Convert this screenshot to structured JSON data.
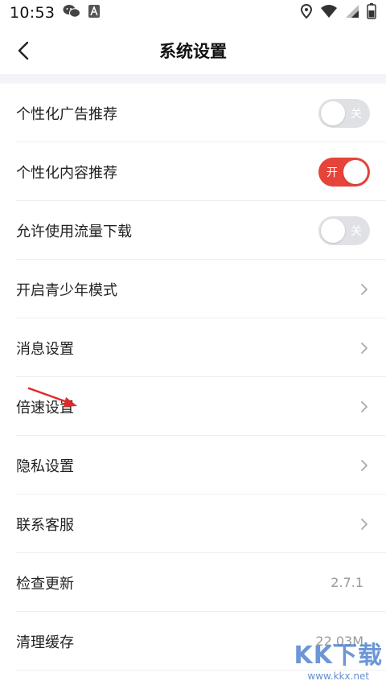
{
  "status": {
    "time": "10:53"
  },
  "header": {
    "title": "系统设置"
  },
  "settings": {
    "items": [
      {
        "label": "个性化广告推荐",
        "toggle_text": "关"
      },
      {
        "label": "个性化内容推荐",
        "toggle_text": "开"
      },
      {
        "label": "允许使用流量下载",
        "toggle_text": "关"
      },
      {
        "label": "开启青少年模式"
      },
      {
        "label": "消息设置"
      },
      {
        "label": "倍速设置"
      },
      {
        "label": "隐私设置"
      },
      {
        "label": "联系客服"
      },
      {
        "label": "检查更新",
        "value": "2.7.1"
      },
      {
        "label": "清理缓存",
        "value": "22.03M"
      }
    ]
  },
  "watermark": {
    "logo": "KK下载",
    "url": "www.kkx.net"
  },
  "colors": {
    "accent": "#e6443a",
    "toggle_off": "#dfe1e5",
    "separator_band": "#f2f4f7"
  }
}
